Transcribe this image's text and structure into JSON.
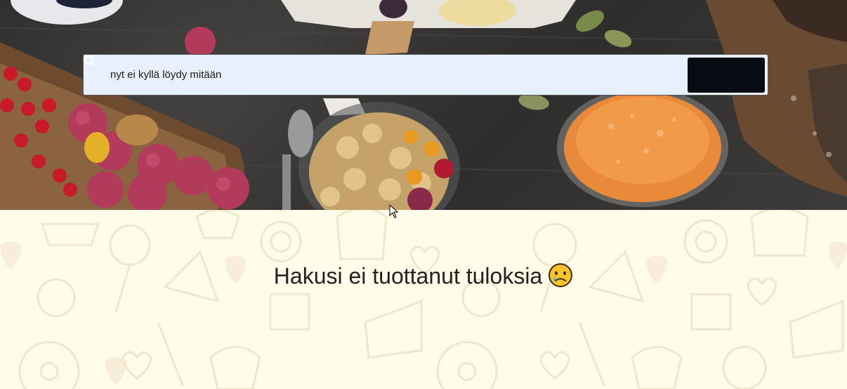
{
  "search": {
    "value": "nyt ei kyllä löydy mitään",
    "button_icon": "search-icon"
  },
  "results": {
    "message": "Hakusi ei tuottanut tuloksia",
    "emoji": "crying-face-icon"
  },
  "colors": {
    "search_bg": "#e8effd",
    "button_bg": "#0a0c14",
    "results_bg": "#fffdea",
    "text": "#212121"
  }
}
